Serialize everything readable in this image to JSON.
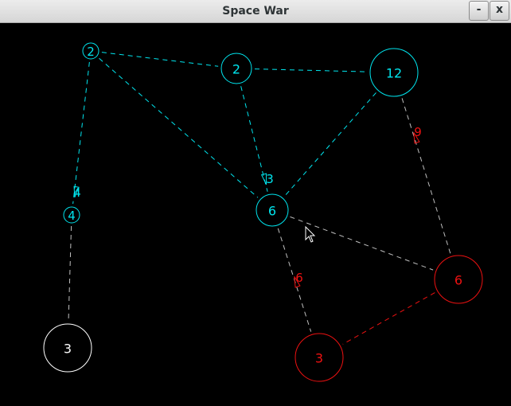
{
  "window": {
    "title": "Space War",
    "minimize_label": "-",
    "close_label": "x"
  },
  "colors": {
    "player": "#00e5ee",
    "enemy": "#ee1111",
    "neutral": "#ffffff",
    "background": "#000000"
  },
  "planets": [
    {
      "id": "p1",
      "owner": "player",
      "ships": "2"
    },
    {
      "id": "p2",
      "owner": "player",
      "ships": "2"
    },
    {
      "id": "p3",
      "owner": "player",
      "ships": "12"
    },
    {
      "id": "p4",
      "owner": "player",
      "ships": "4"
    },
    {
      "id": "p5",
      "owner": "player",
      "ships": "6"
    },
    {
      "id": "p6",
      "owner": "enemy",
      "ships": "6"
    },
    {
      "id": "p7",
      "owner": "enemy",
      "ships": "3"
    },
    {
      "id": "p8",
      "owner": "neutral",
      "ships": "3"
    }
  ],
  "routes": [
    {
      "from": "p1",
      "to": "p2",
      "owner": "player"
    },
    {
      "from": "p2",
      "to": "p3",
      "owner": "player"
    },
    {
      "from": "p1",
      "to": "p5",
      "owner": "player"
    },
    {
      "from": "p2",
      "to": "p5",
      "owner": "player"
    },
    {
      "from": "p3",
      "to": "p5",
      "owner": "player"
    },
    {
      "from": "p1",
      "to": "p4",
      "owner": "player"
    },
    {
      "from": "p4",
      "to": "p8",
      "owner": "neutral"
    },
    {
      "from": "p5",
      "to": "p6",
      "owner": "neutral"
    },
    {
      "from": "p5",
      "to": "p7",
      "owner": "neutral"
    },
    {
      "from": "p3",
      "to": "p6",
      "owner": "neutral"
    },
    {
      "from": "p6",
      "to": "p7",
      "owner": "enemy"
    }
  ],
  "fleets": [
    {
      "id": "f1",
      "owner": "player",
      "ships": "4"
    },
    {
      "id": "f2",
      "owner": "player",
      "ships": "3"
    },
    {
      "id": "f3",
      "owner": "enemy",
      "ships": "9"
    },
    {
      "id": "f4",
      "owner": "enemy",
      "ships": "6"
    }
  ]
}
